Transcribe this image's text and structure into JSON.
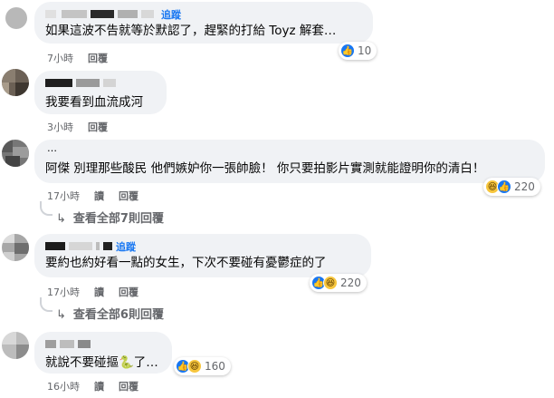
{
  "ui": {
    "follow_label": "追蹤",
    "reply_label": "回覆",
    "hide_label": "讀",
    "accent": "#1877f2"
  },
  "comments": [
    {
      "text": "如果這波不告就等於默認了，趕緊的打給 Toyz 解套…",
      "time": "7小時",
      "reaction_count": "10",
      "reactions": [
        "like-icon"
      ],
      "follow_shown": true
    },
    {
      "text": "我要看到血流成河",
      "time": "3小時",
      "reaction_count": "",
      "reactions": [],
      "follow_shown": false
    },
    {
      "name_prefix": "…",
      "text": "阿傑 別理那些酸民 他們嫉妒你一張帥臉！ 你只要拍影片實測就能證明你的清白！",
      "time": "17小時",
      "reaction_count": "220",
      "reactions": [
        "haha-icon",
        "like-icon"
      ],
      "view_replies": "查看全部7則回覆",
      "follow_shown": false
    },
    {
      "text": "要約也約好看一點的女生，下次不要碰有憂鬱症的了",
      "time": "17小時",
      "reaction_count": "220",
      "reactions": [
        "like-icon",
        "haha-icon"
      ],
      "view_replies": "查看全部6則回覆",
      "follow_shown": true
    },
    {
      "text": "就說不要碰摳🐍了…",
      "time": "16小時",
      "reaction_count": "160",
      "reactions": [
        "like-icon",
        "haha-icon"
      ],
      "follow_shown": false
    }
  ]
}
